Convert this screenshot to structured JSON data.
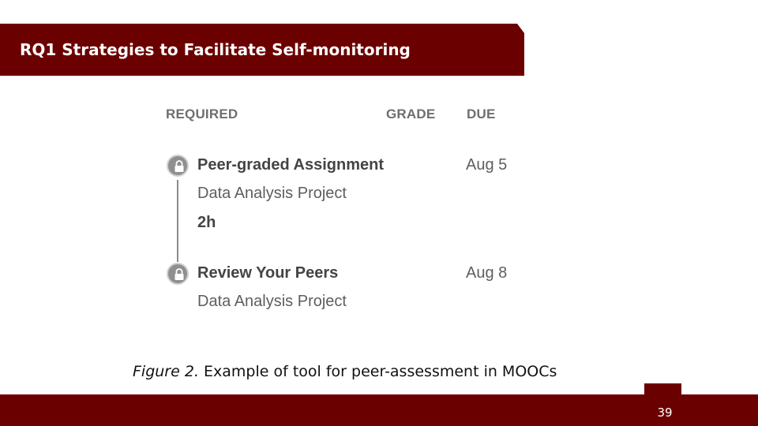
{
  "slide": {
    "title": "RQ1 Strategies to Facilitate Self-monitoring",
    "page_number": "39"
  },
  "figure": {
    "headers": {
      "required": "REQUIRED",
      "grade": "GRADE",
      "due": "DUE"
    },
    "items": [
      {
        "title": "Peer-graded Assignment",
        "subtitle": "Data Analysis Project",
        "duration": "2h",
        "due": "Aug 5",
        "icon": "lock-icon"
      },
      {
        "title": "Review Your Peers",
        "subtitle": "Data Analysis Project",
        "due": "Aug 8",
        "icon": "lock-icon"
      }
    ],
    "caption_label": "Figure 2.",
    "caption_text": " Example of tool for peer-assessment in MOOCs"
  },
  "colors": {
    "brand": "#6b0000",
    "text_gray": "#5e5e5e",
    "lock_gray": "#8f8f8f"
  }
}
